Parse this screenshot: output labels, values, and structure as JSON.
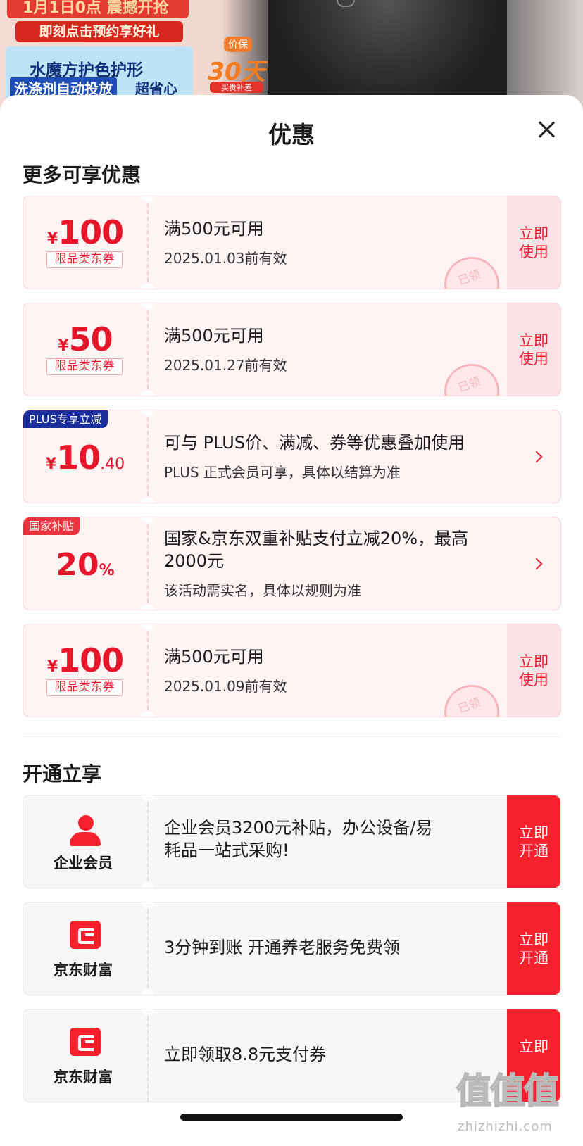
{
  "background": {
    "banner_line1": "1月1日0点 震撼开抢",
    "banner_line2": "即刻点击预约享好礼",
    "promo_line1": "水魔方护色护形",
    "promo_line2a": "洗涤剂自动投放",
    "promo_line2b": "超省心",
    "badge_top": "价保",
    "badge_main": "30天",
    "badge_bottom": "买贵补差"
  },
  "sheet": {
    "title": "优惠",
    "close_icon": "close-icon"
  },
  "sections": {
    "more_title": "更多可享优惠",
    "open_title": "开通立享"
  },
  "coupons": [
    {
      "yen": "¥",
      "amount": "100",
      "tag": "限品类东券",
      "condition": "满500元可用",
      "validity": "2025.01.03前有效",
      "action": "立即使用",
      "stamp": "已领"
    },
    {
      "yen": "¥",
      "amount": "50",
      "tag": "限品类东券",
      "condition": "满500元可用",
      "validity": "2025.01.27前有效",
      "action": "立即使用",
      "stamp": "已领"
    }
  ],
  "plus": {
    "corner": "PLUS专享立减",
    "yen": "¥",
    "amount": "10",
    "decimal": ".40",
    "main": "可与 PLUS价、满减、券等优惠叠加使用",
    "sub": "PLUS 正式会员可享，具体以结算为准"
  },
  "gov": {
    "corner": "国家补贴",
    "percent": "20",
    "unit": "%",
    "main_line1": "国家&京东双重补贴支付立减20%，最高",
    "main_line2": "2000元",
    "sub": "该活动需实名，具体以规则为准"
  },
  "coupon3": {
    "yen": "¥",
    "amount": "100",
    "tag": "限品类东券",
    "condition": "满500元可用",
    "validity": "2025.01.09前有效",
    "action": "立即使用",
    "stamp": "已领"
  },
  "services": [
    {
      "label": "企业会员",
      "line1": "企业会员3200元补贴，办公设备/易",
      "line2": "耗品一站式采购!",
      "action": "立即开通"
    },
    {
      "label": "京东财富",
      "line1": "3分钟到账 开通养老服务免费领",
      "line2": "",
      "action": "立即开通"
    },
    {
      "label": "京东财富",
      "line1": "立即领取8.8元支付券",
      "line2": "",
      "action": "立即"
    }
  ],
  "watermark": {
    "big": "值值值",
    "small": "zhizhizhi.com"
  },
  "colors": {
    "accent": "#e6162b",
    "action_solid": "#f5212d",
    "card_bg": "#fff3f4",
    "plus_badge": "#1b2f9a"
  }
}
